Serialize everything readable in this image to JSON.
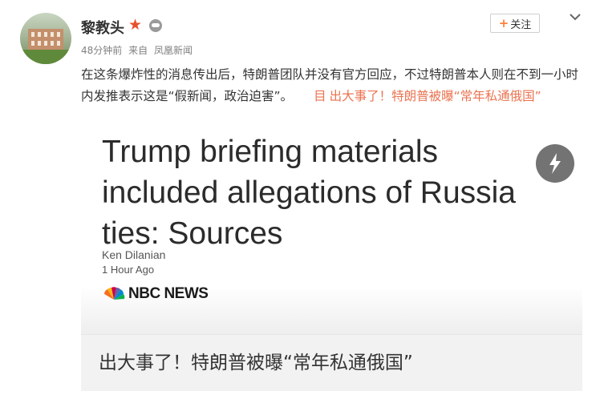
{
  "user": {
    "name": "黎教头",
    "avatar_icon": "avatar-photo",
    "verified_icon": "star-icon",
    "badge_icon": "member-badge-icon"
  },
  "meta": {
    "time": "48分钟前",
    "source_prefix": "来自",
    "source": "凤凰新闻"
  },
  "follow_button": {
    "plus": "+",
    "label": "关注"
  },
  "post": {
    "text": "在这条爆炸性的消息传出后，特朗普团队并没有官方回应，不过特朗普本人则在不到一小时内发推表示这是“假新闻，政治迫害”。",
    "link_icon": "目",
    "link_text": "出大事了！特朗普被曝“常年私通俄国”"
  },
  "card": {
    "headline": "Trump briefing materials included allegations of Russia ties: Sources",
    "byline": "Ken Dilanian",
    "time_ago": "1 Hour Ago",
    "logo_text": "NBC NEWS",
    "caption": "出大事了！特朗普被曝“常年私通俄国”"
  },
  "colors": {
    "link": "#eb7350",
    "star": "#e84f2d",
    "follow_plus": "#ff8140"
  }
}
